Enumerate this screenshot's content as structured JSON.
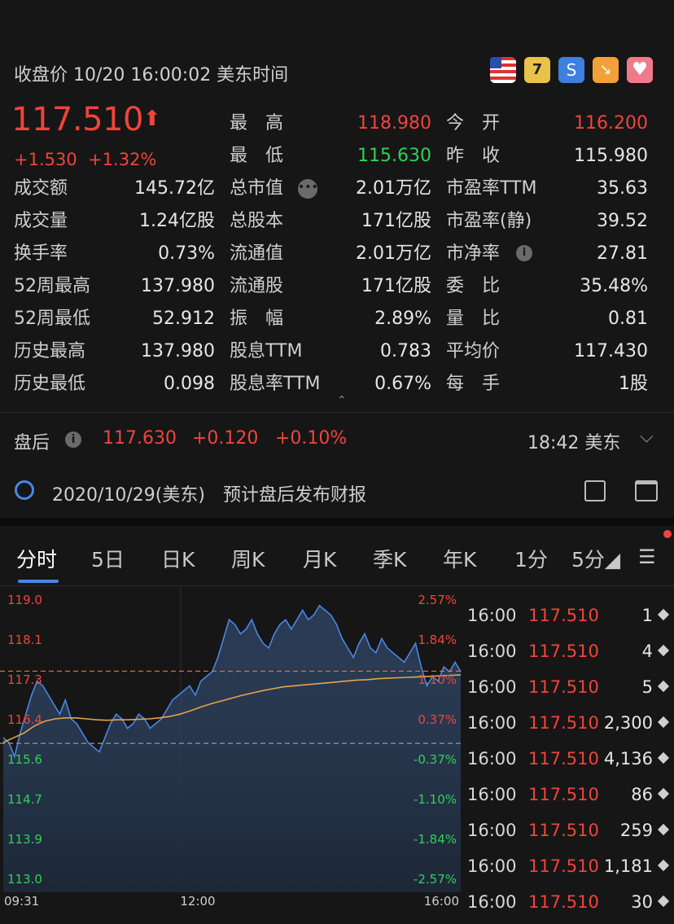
{
  "header": {
    "title": "收盘价 10/20 16:00:02 美东时间"
  },
  "quote": {
    "price": "117.510",
    "change": "+1.530",
    "change_pct": "+1.32%"
  },
  "stats": {
    "left": [
      {
        "label": "成交额",
        "value": "145.72亿"
      },
      {
        "label": "成交量",
        "value": "1.24亿股"
      },
      {
        "label": "换手率",
        "value": "0.73%"
      },
      {
        "label": "52周最高",
        "value": "137.980"
      },
      {
        "label": "52周最低",
        "value": "52.912"
      },
      {
        "label": "历史最高",
        "value": "137.980"
      },
      {
        "label": "历史最低",
        "value": "0.098"
      }
    ],
    "mid": [
      {
        "label": "最　高",
        "value": "118.980",
        "color": "red"
      },
      {
        "label": "最　低",
        "value": "115.630",
        "color": "green"
      },
      {
        "label": "总市值",
        "value": "2.01万亿"
      },
      {
        "label": "总股本",
        "value": "171亿股"
      },
      {
        "label": "流通值",
        "value": "2.01万亿"
      },
      {
        "label": "流通股",
        "value": "171亿股"
      },
      {
        "label": "振　幅",
        "value": "2.89%"
      },
      {
        "label": "股息TTM",
        "value": "0.783"
      },
      {
        "label": "股息率TTM",
        "value": "0.67%"
      }
    ],
    "right": [
      {
        "label": "今　开",
        "value": "116.200",
        "color": "red"
      },
      {
        "label": "昨　收",
        "value": "115.980"
      },
      {
        "label": "市盈率TTM",
        "value": "35.63"
      },
      {
        "label": "市盈率(静)",
        "value": "39.52"
      },
      {
        "label": "市净率",
        "value": "27.81"
      },
      {
        "label": "委　比",
        "value": "35.48%"
      },
      {
        "label": "量　比",
        "value": "0.81"
      },
      {
        "label": "平均价",
        "value": "117.430"
      },
      {
        "label": "每　手",
        "value": "1股"
      }
    ]
  },
  "after_hours": {
    "label": "盘后",
    "price": "117.630",
    "change": "+0.120",
    "change_pct": "+0.10%",
    "time": "18:42 美东"
  },
  "event": {
    "text": "2020/10/29(美东)　预计盘后发布财报"
  },
  "tabs": [
    "分时",
    "5日",
    "日K",
    "周K",
    "月K",
    "季K",
    "年K",
    "1分",
    "5分"
  ],
  "chart_data": {
    "type": "line",
    "x_labels": [
      "09:31",
      "12:00",
      "16:00"
    ],
    "y_ticks_left": [
      "119.0",
      "118.1",
      "117.3",
      "116.4",
      "115.6",
      "114.7",
      "113.9",
      "113.0"
    ],
    "y_ticks_right": [
      "2.57%",
      "1.84%",
      "1.10%",
      "0.37%",
      "-0.37%",
      "-1.10%",
      "-1.84%",
      "-2.57%"
    ],
    "ylim": [
      113.0,
      119.0
    ],
    "prev_close": 115.98,
    "last_price": 117.51,
    "series": [
      {
        "color": "#4a86e8",
        "values": [
          116.1,
          116.0,
          115.7,
          116.2,
          116.6,
          117.0,
          117.3,
          117.2,
          117.0,
          116.8,
          116.6,
          116.9,
          116.5,
          116.4,
          116.2,
          116.0,
          115.9,
          115.8,
          116.1,
          116.4,
          116.6,
          116.5,
          116.3,
          116.4,
          116.6,
          116.5,
          116.3,
          116.4,
          116.5,
          116.7,
          116.9,
          117.0,
          117.1,
          117.2,
          117.0,
          117.3,
          117.4,
          117.5,
          117.8,
          118.2,
          118.6,
          118.5,
          118.3,
          118.4,
          118.6,
          118.3,
          118.1,
          118.0,
          118.3,
          118.5,
          118.6,
          118.4,
          118.6,
          118.8,
          118.6,
          118.7,
          118.9,
          118.8,
          118.7,
          118.5,
          118.2,
          118.0,
          117.8,
          118.1,
          118.3,
          118.0,
          117.9,
          118.2,
          118.0,
          117.9,
          117.8,
          117.7,
          117.9,
          118.1,
          117.6,
          117.2,
          117.4,
          117.3,
          117.6,
          117.5,
          117.7,
          117.5
        ]
      },
      {
        "color": "#e3a54a",
        "values": [
          116.0,
          116.1,
          116.2,
          116.35,
          116.45,
          116.5,
          116.52,
          116.52,
          116.5,
          116.48,
          116.47,
          116.48,
          116.48,
          116.49,
          116.5,
          116.52,
          116.55,
          116.6,
          116.67,
          116.75,
          116.82,
          116.88,
          116.94,
          117.0,
          117.05,
          117.1,
          117.14,
          117.18,
          117.2,
          117.22,
          117.24,
          117.26,
          117.28,
          117.3,
          117.32,
          117.33,
          117.35,
          117.36,
          117.37,
          117.38,
          117.39,
          117.4,
          117.41,
          117.42,
          117.43
        ]
      }
    ]
  },
  "trades": [
    {
      "time": "16:00",
      "price": "117.510",
      "vol": "1"
    },
    {
      "time": "16:00",
      "price": "117.510",
      "vol": "4"
    },
    {
      "time": "16:00",
      "price": "117.510",
      "vol": "5"
    },
    {
      "time": "16:00",
      "price": "117.510",
      "vol": "2,300"
    },
    {
      "time": "16:00",
      "price": "117.510",
      "vol": "4,136"
    },
    {
      "time": "16:00",
      "price": "117.510",
      "vol": "86"
    },
    {
      "time": "16:00",
      "price": "117.510",
      "vol": "259"
    },
    {
      "time": "16:00",
      "price": "117.510",
      "vol": "1,181"
    },
    {
      "time": "16:00",
      "price": "117.510",
      "vol": "30"
    }
  ]
}
